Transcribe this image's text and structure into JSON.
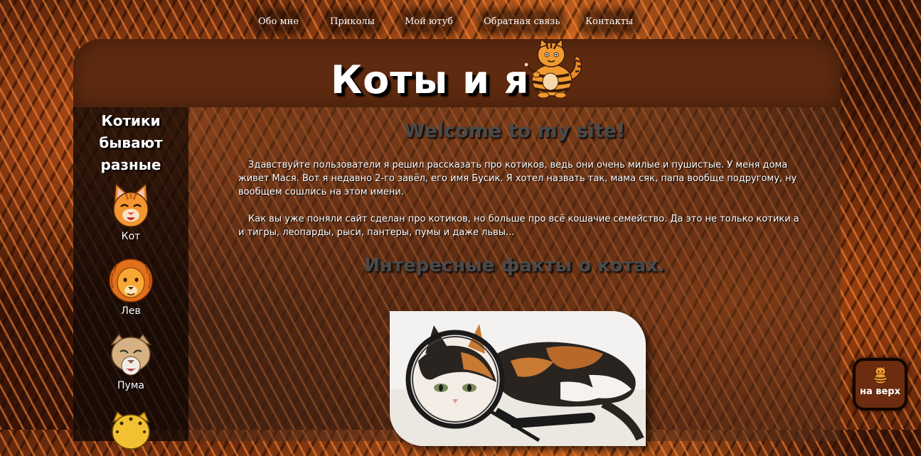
{
  "nav": {
    "items": [
      {
        "label": "Обо мне"
      },
      {
        "label": "Приколы"
      },
      {
        "label": "Мой ютуб"
      },
      {
        "label": "Обратная связь"
      },
      {
        "label": "Контакты"
      }
    ]
  },
  "header": {
    "title": "Коты и я"
  },
  "sidebar": {
    "title_lines": [
      "Котики",
      "бывают",
      "разные"
    ],
    "items": [
      {
        "label": "Кот",
        "icon": "cat-face-icon"
      },
      {
        "label": "Лев",
        "icon": "lion-face-icon"
      },
      {
        "label": "Пума",
        "icon": "puma-face-icon"
      },
      {
        "label": "",
        "icon": "leopard-face-icon"
      }
    ]
  },
  "main": {
    "welcome": "Welcome to my site!",
    "paragraphs": [
      "Здавствуйте пользователи я решил рассказать про котиков, ведь они очень милые и пушистые. У меня дома живет Мася. Вот я недавно 2-го завёл, его имя Бусик. Я хотел назвать так, мама сяк, папа вообще подругому, ну вообщем сошлись на этом имени.",
      "Как вы уже поняли сайт сделан про котиков, но больше про всё кошачие семейство. Да это не только котики а и тигры, леопарды, рыси, пантеры, пумы и даже львы..."
    ],
    "facts_heading": "Интересные факты о котах."
  },
  "to_top": {
    "label": "на верх"
  },
  "colors": {
    "header_bg": "#5e2a10",
    "sidebar_bg": "#120a06",
    "heading_text": "#4a4a4a",
    "button_bg": "#6b2c10"
  }
}
